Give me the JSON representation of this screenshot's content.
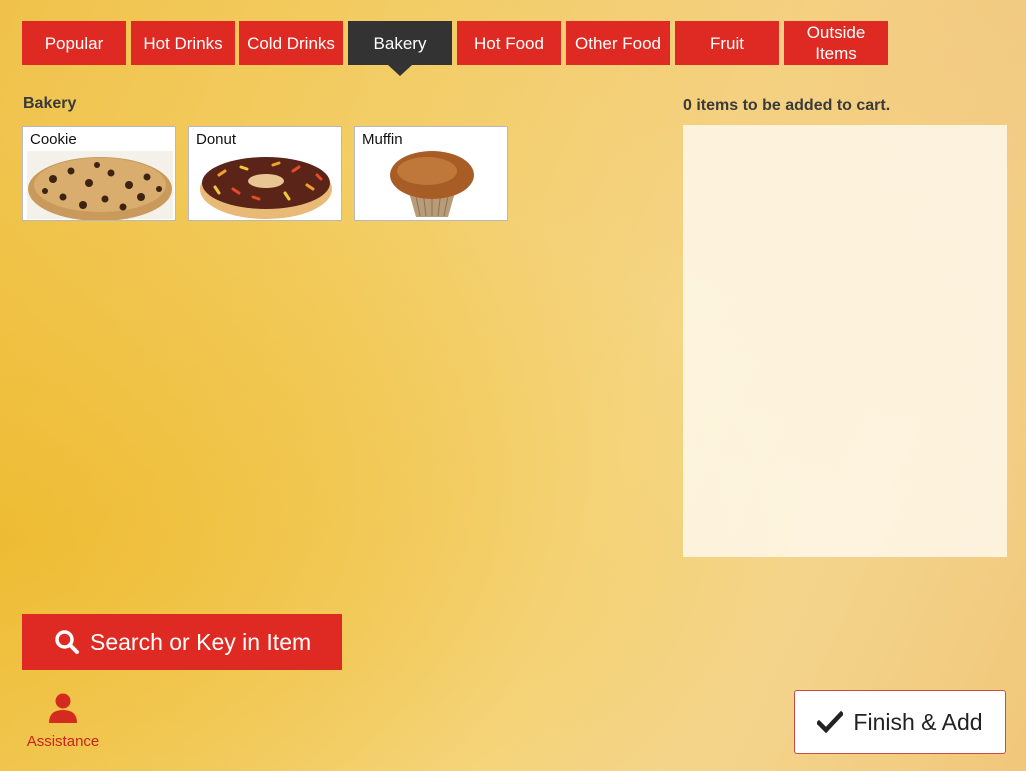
{
  "tabs": [
    {
      "label": "Popular",
      "active": false
    },
    {
      "label": "Hot Drinks",
      "active": false
    },
    {
      "label": "Cold Drinks",
      "active": false
    },
    {
      "label": "Bakery",
      "active": true
    },
    {
      "label": "Hot Food",
      "active": false
    },
    {
      "label": "Other Food",
      "active": false
    },
    {
      "label": "Fruit",
      "active": false
    },
    {
      "label": "Outside Items",
      "active": false
    }
  ],
  "section": {
    "title": "Bakery"
  },
  "items": [
    {
      "name": "Cookie",
      "icon": "cookie-image"
    },
    {
      "name": "Donut",
      "icon": "donut-image"
    },
    {
      "name": "Muffin",
      "icon": "muffin-image"
    }
  ],
  "cart": {
    "status": "0 items to be added to cart."
  },
  "actions": {
    "search_label": "Search or Key in Item",
    "assistance_label": "Assistance",
    "finish_label": "Finish & Add"
  },
  "colors": {
    "accent": "#de2a22",
    "active_tab": "#333333",
    "background": "#f3cf68"
  }
}
